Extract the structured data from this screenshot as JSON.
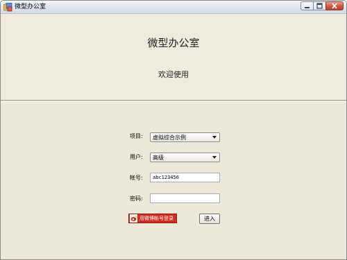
{
  "window": {
    "title": "微型办公室"
  },
  "header": {
    "app_title": "微型办公室",
    "welcome": "欢迎使用"
  },
  "form": {
    "project_label": "项目:",
    "project_value": "虚拟综合示例",
    "user_label": "用户:",
    "user_value": "高级",
    "account_label": "帐号:",
    "account_value": "abc123456",
    "password_label": "密码:",
    "password_value": ""
  },
  "buttons": {
    "weibo_login": "用微博帐号登录",
    "enter": "进入"
  },
  "colors": {
    "window_bg": "#ece9d8",
    "weibo_red": "#d42a1e",
    "close_red": "#c0402a"
  }
}
